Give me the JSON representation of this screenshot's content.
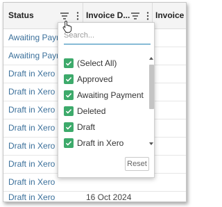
{
  "header": {
    "columns": [
      {
        "label": "Status"
      },
      {
        "label": "Invoice D..."
      },
      {
        "label": "Invoice"
      }
    ]
  },
  "rows": [
    {
      "status": "Awaiting Payment",
      "date": ""
    },
    {
      "status": "Awaiting Payment",
      "date": ""
    },
    {
      "status": "Draft in Xero",
      "date": ""
    },
    {
      "status": "Draft in Xero",
      "date": ""
    },
    {
      "status": "Draft in Xero",
      "date": ""
    },
    {
      "status": "Draft in Xero",
      "date": ""
    },
    {
      "status": "Draft in Xero",
      "date": ""
    },
    {
      "status": "Draft in Xero",
      "date": ""
    },
    {
      "status": "Draft in Xero",
      "date": ""
    },
    {
      "status": "Draft in Xero",
      "date": "16 Oct 2024"
    }
  ],
  "filter_menu": {
    "search_placeholder": "Search...",
    "options": [
      {
        "label": "(Select All)",
        "checked": true
      },
      {
        "label": "Approved",
        "checked": true
      },
      {
        "label": "Awaiting Payment",
        "checked": true
      },
      {
        "label": "Deleted",
        "checked": true
      },
      {
        "label": "Draft",
        "checked": true
      },
      {
        "label": "Draft in Xero",
        "checked": true
      }
    ],
    "reset_label": "Reset",
    "checkbox_color": "#3daa6b"
  },
  "icons": {
    "filter": "filter-icon",
    "menu": "vertical-dots-icon",
    "cursor": "hand-pointer-icon"
  }
}
